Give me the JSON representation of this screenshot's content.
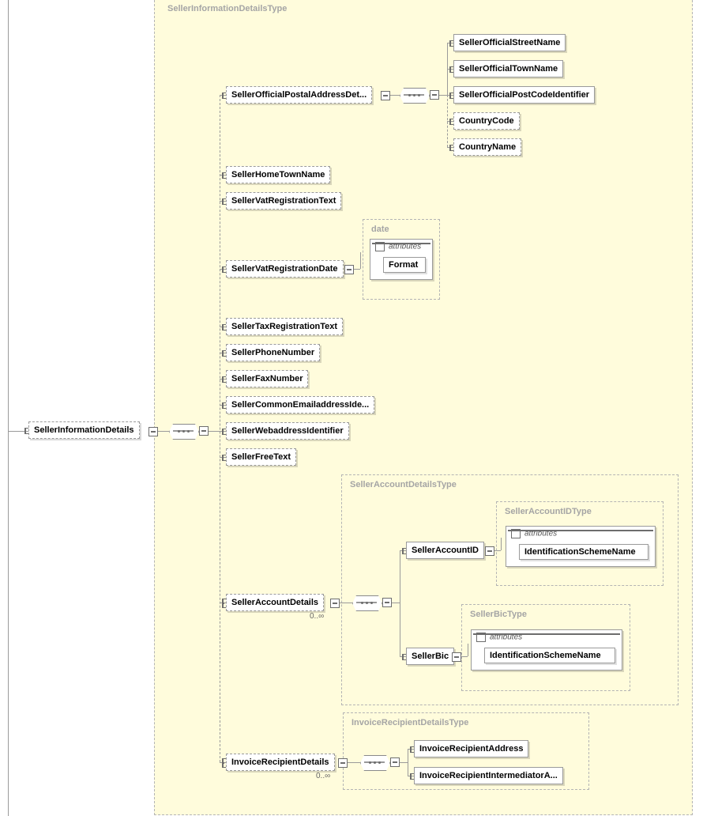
{
  "group_labels": {
    "main": "SellerInformationDetailsType",
    "date": "date",
    "account_details": "SellerAccountDetailsType",
    "account_id": "SellerAccountIDType",
    "bic": "SellerBicType",
    "invoice_recipient": "InvoiceRecipientDetailsType"
  },
  "root": "SellerInformationDetails",
  "children": {
    "postal": "SellerOfficialPostalAddressDet...",
    "hometown": "SellerHomeTownName",
    "vat_text": "SellerVatRegistrationText",
    "vat_date": "SellerVatRegistrationDate",
    "tax_text": "SellerTaxRegistrationText",
    "phone": "SellerPhoneNumber",
    "fax": "SellerFaxNumber",
    "email": "SellerCommonEmailaddressIde...",
    "web": "SellerWebaddressIdentifier",
    "free_text": "SellerFreeText",
    "account_details": "SellerAccountDetails",
    "invoice_recipient": "InvoiceRecipientDetails"
  },
  "postal_children": {
    "street": "SellerOfficialStreetName",
    "town": "SellerOfficialTownName",
    "postcode": "SellerOfficialPostCodeIdentifier",
    "country_code": "CountryCode",
    "country_name": "CountryName"
  },
  "date_attr": {
    "label": "attributes",
    "child": "Format"
  },
  "account": {
    "id": "SellerAccountID",
    "bic": "SellerBic",
    "attr_label": "attributes",
    "scheme": "IdentificationSchemeName"
  },
  "invoice": {
    "address": "InvoiceRecipientAddress",
    "intermediator": "InvoiceRecipientIntermediatorA..."
  },
  "cardinality": {
    "zero_inf": "0..∞"
  }
}
